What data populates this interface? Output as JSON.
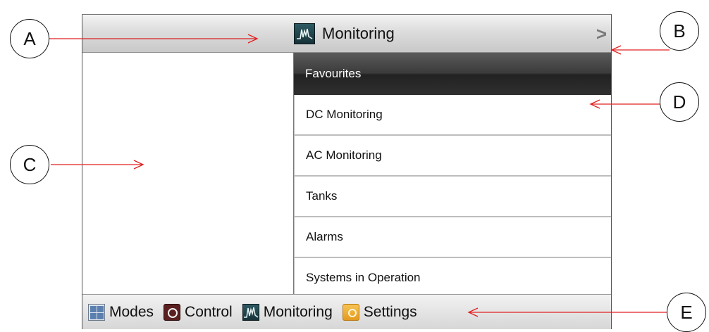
{
  "header": {
    "title": "Monitoring",
    "title_icon": "monitoring-icon",
    "next_icon": "chevron-right-icon"
  },
  "menu": {
    "items": [
      {
        "label": "Favourites",
        "active": true
      },
      {
        "label": "DC Monitoring"
      },
      {
        "label": "AC Monitoring"
      },
      {
        "label": "Tanks"
      },
      {
        "label": "Alarms"
      },
      {
        "label": "Systems in Operation"
      }
    ]
  },
  "bottom_bar": {
    "items": [
      {
        "label": "Modes",
        "icon": "modes-icon"
      },
      {
        "label": "Control",
        "icon": "control-icon"
      },
      {
        "label": "Monitoring",
        "icon": "monitoring-icon"
      },
      {
        "label": "Settings",
        "icon": "settings-icon"
      }
    ]
  },
  "callouts": {
    "a": "A",
    "b": "B",
    "c": "C",
    "d": "D",
    "e": "E"
  },
  "colors": {
    "arrow": "#e02020",
    "active_row": "#2f2f2f"
  }
}
